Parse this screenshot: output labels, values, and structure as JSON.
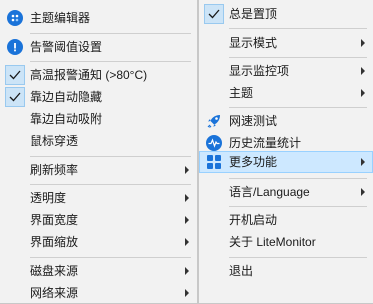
{
  "left_menu": {
    "items": [
      {
        "label": "主题编辑器",
        "icon": "palette-icon"
      },
      {
        "label": "告警阈值设置",
        "icon": "alert-icon"
      },
      {
        "label": "高温报警通知 (>80°C)",
        "checked": true
      },
      {
        "label": "靠边自动隐藏",
        "checked": true
      },
      {
        "label": "靠边自动吸附"
      },
      {
        "label": "鼠标穿透"
      },
      {
        "label": "刷新频率",
        "submenu": true
      },
      {
        "label": "透明度",
        "submenu": true
      },
      {
        "label": "界面宽度",
        "submenu": true
      },
      {
        "label": "界面缩放",
        "submenu": true
      },
      {
        "label": "磁盘来源",
        "submenu": true
      },
      {
        "label": "网络来源",
        "submenu": true
      }
    ]
  },
  "right_menu": {
    "items": [
      {
        "label": "总是置顶",
        "checked": true
      },
      {
        "label": "显示模式",
        "submenu": true
      },
      {
        "label": "显示监控项",
        "submenu": true
      },
      {
        "label": "主题",
        "submenu": true
      },
      {
        "label": "网速测试",
        "icon": "rocket-icon"
      },
      {
        "label": "历史流量统计",
        "icon": "pulse-icon"
      },
      {
        "label": "更多功能",
        "icon": "apps-grid-icon",
        "submenu": true,
        "highlighted": true
      },
      {
        "label": "语言/Language",
        "submenu": true
      },
      {
        "label": "开机启动"
      },
      {
        "label": "关于 LiteMonitor"
      },
      {
        "label": "退出"
      }
    ]
  },
  "colors": {
    "accent": "#1a73d9",
    "highlight_bg": "#cde8ff",
    "check_bg": "#cce4f7"
  }
}
